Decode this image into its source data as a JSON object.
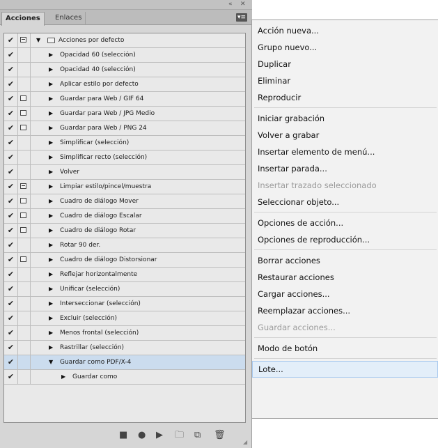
{
  "panel": {
    "tabs": [
      "Acciones",
      "Enlaces"
    ],
    "collapse_glyph": "«",
    "close_glyph": "✕",
    "menu_glyph": "▾≡",
    "check_glyph": "✔"
  },
  "actions": [
    {
      "label": "Acciones por defecto",
      "dialog": "partial",
      "level": 0,
      "expanded": true,
      "folder": true
    },
    {
      "label": "Opacidad 60 (selección)",
      "dialog": "none",
      "level": 1
    },
    {
      "label": "Opacidad 40 (selección)",
      "dialog": "none",
      "level": 1
    },
    {
      "label": "Aplicar estilo por defecto",
      "dialog": "none",
      "level": 1
    },
    {
      "label": "Guardar para Web / GIF 64",
      "dialog": "box",
      "level": 1
    },
    {
      "label": "Guardar para Web / JPG Medio",
      "dialog": "box",
      "level": 1
    },
    {
      "label": "Guardar para Web / PNG 24",
      "dialog": "box",
      "level": 1
    },
    {
      "label": "Simplificar (selección)",
      "dialog": "none",
      "level": 1
    },
    {
      "label": "Simplificar recto (selección)",
      "dialog": "none",
      "level": 1
    },
    {
      "label": "Volver",
      "dialog": "none",
      "level": 1
    },
    {
      "label": "Limpiar estilo/pincel/muestra",
      "dialog": "partial",
      "level": 1
    },
    {
      "label": "Cuadro de diálogo Mover",
      "dialog": "box",
      "level": 1
    },
    {
      "label": "Cuadro de diálogo Escalar",
      "dialog": "box",
      "level": 1
    },
    {
      "label": "Cuadro de diálogo Rotar",
      "dialog": "box",
      "level": 1
    },
    {
      "label": "Rotar 90 der.",
      "dialog": "none",
      "level": 1
    },
    {
      "label": "Cuadro de diálogo Distorsionar",
      "dialog": "box",
      "level": 1
    },
    {
      "label": "Reflejar horizontalmente",
      "dialog": "none",
      "level": 1
    },
    {
      "label": "Unificar (selección)",
      "dialog": "none",
      "level": 1
    },
    {
      "label": "Interseccionar (selección)",
      "dialog": "none",
      "level": 1
    },
    {
      "label": "Excluir (selección)",
      "dialog": "none",
      "level": 1
    },
    {
      "label": "Menos frontal (selección)",
      "dialog": "none",
      "level": 1
    },
    {
      "label": "Rastrillar (selección)",
      "dialog": "none",
      "level": 1
    },
    {
      "label": "Guardar como PDF/X-4",
      "dialog": "none",
      "level": 1,
      "expanded": true,
      "selected": true
    },
    {
      "label": "Guardar como",
      "dialog": "none",
      "level": 2
    }
  ],
  "bottom_icons": [
    {
      "name": "stop-icon",
      "glyph": "■"
    },
    {
      "name": "record-icon",
      "glyph": "●"
    },
    {
      "name": "play-icon",
      "glyph": "▶"
    },
    {
      "name": "new-set-folder-icon",
      "glyph": "🗀"
    },
    {
      "name": "new-action-icon",
      "glyph": "⧉"
    },
    {
      "name": "trash-icon",
      "glyph": "🗑"
    }
  ],
  "menu": [
    {
      "label": "Acción nueva...",
      "state": "enabled",
      "group": 1
    },
    {
      "label": "Grupo nuevo...",
      "state": "enabled",
      "group": 1
    },
    {
      "label": "Duplicar",
      "state": "enabled",
      "group": 1
    },
    {
      "label": "Eliminar",
      "state": "enabled",
      "group": 1
    },
    {
      "label": "Reproducir",
      "state": "enabled",
      "group": 1
    },
    {
      "label": "Iniciar grabación",
      "state": "enabled",
      "group": 2
    },
    {
      "label": "Volver a grabar",
      "state": "enabled",
      "group": 2
    },
    {
      "label": "Insertar elemento de menú...",
      "state": "enabled",
      "group": 2
    },
    {
      "label": "Insertar parada...",
      "state": "enabled",
      "group": 2
    },
    {
      "label": "Insertar trazado seleccionado",
      "state": "disabled",
      "group": 2
    },
    {
      "label": "Seleccionar objeto...",
      "state": "enabled",
      "group": 2
    },
    {
      "label": "Opciones de acción...",
      "state": "enabled",
      "group": 3
    },
    {
      "label": "Opciones de reproducción...",
      "state": "enabled",
      "group": 3
    },
    {
      "label": "Borrar acciones",
      "state": "enabled",
      "group": 4
    },
    {
      "label": "Restaurar acciones",
      "state": "enabled",
      "group": 4
    },
    {
      "label": "Cargar acciones...",
      "state": "enabled",
      "group": 4
    },
    {
      "label": "Reemplazar acciones...",
      "state": "enabled",
      "group": 4
    },
    {
      "label": "Guardar acciones...",
      "state": "disabled",
      "group": 4
    },
    {
      "label": "Modo de botón",
      "state": "enabled",
      "group": 5
    },
    {
      "label": "Lote...",
      "state": "hover",
      "group": 6
    }
  ]
}
